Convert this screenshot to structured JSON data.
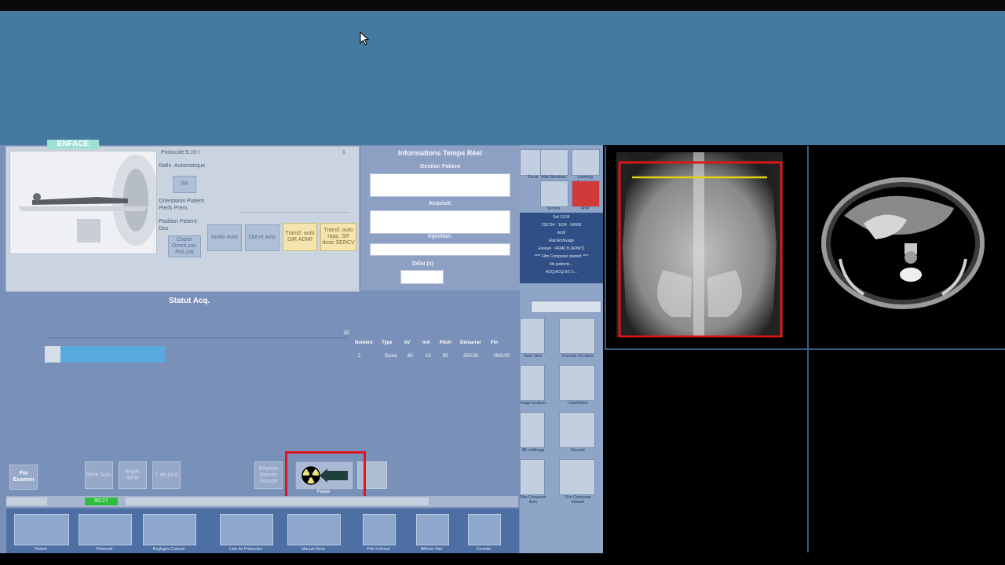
{
  "protocol": {
    "tab": "ENFACE",
    "protocol_label": "Protocole:5.10 I",
    "index": "1",
    "region_label": "Rafin. Automatique",
    "region_button": "SR",
    "orientation_label": "Orientation Patient",
    "orientation_value": "Pieds Prem.",
    "position_label": "Position Patient",
    "position_value": "Dos",
    "buttons": {
      "copy": "Copier Orient.pat. Pos.pat",
      "auto_anat": "Anato Auto",
      "auto_opt": "Opt.et auto",
      "transf_dir": "Transf. auto DIR ADWI",
      "transf_rapp": "Transf. auto rapp. SR dose SERCV"
    }
  },
  "realtime": {
    "title": "Informations Temps Réel",
    "gestion": "Gestion Patient",
    "acquisit": "Acquisit.",
    "injection": "Injection.",
    "delai": "Délai (s)"
  },
  "status": {
    "title": "Statut Acq.",
    "progress_max": "10",
    "progress_fraction": 0.4,
    "columns": [
      "Numéro",
      "Type",
      "kV",
      "mA",
      "Pitch",
      "Démarrer",
      "Fin"
    ],
    "row": [
      "2",
      "Scout",
      "80",
      "10",
      "90",
      "S00.00",
      "I400.00"
    ]
  },
  "bottom_buttons": {
    "fin_examen": "Fin Examen",
    "serie_suiv": "Série Suiv.",
    "repet_serie": "Répét. Série",
    "un_de_plus": "1 de plus",
    "repeter_groupe": "Répéter Dernier Groupe",
    "rad_label": "Pause"
  },
  "statusbar": {
    "green": "00:27"
  },
  "taskbar": [
    "Patient",
    "Protocole",
    "Reglages Cuisson",
    "Liste de Protocoles",
    "Manuel Série",
    "Prêt à Revoir",
    "Afficher Hist.",
    "Console"
  ],
  "side_panel": {
    "top_labels": [
      "Écran",
      "Aide Windows",
      "Learning Solutions",
      "Service",
      "Arrêt"
    ],
    "info_lines": [
      "Sel 13:26",
      "216734 · 1024 · 54003",
      "AcW",
      "Etat Archivage",
      "Envoyé : 44340 B (ADWT)",
      "**** Film Composer started ****",
      "No patients...",
      "ACQ ACQ-3/1-1..."
    ],
    "icon_labels": [
      "Auto View",
      "Formats d'écriture",
      "Image analysis",
      "Liste/Sélect",
      "Aff. calibrage",
      "Sécurité",
      "Film Composer Auto",
      "Film Composer Manuel"
    ]
  },
  "colors": {
    "highlight": "#e0141a",
    "progress": "#5aa9de",
    "status_green": "#2fbe3c"
  }
}
